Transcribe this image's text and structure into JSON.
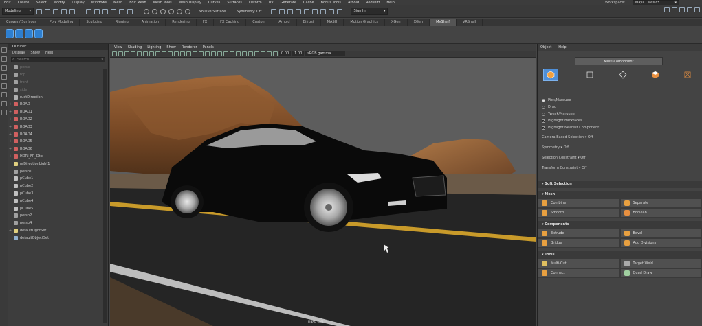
{
  "menubar": [
    "Edit",
    "Create",
    "Select",
    "Modify",
    "Display",
    "Windows",
    "Mesh",
    "Edit Mesh",
    "Mesh Tools",
    "Mesh Display",
    "Curves",
    "Surfaces",
    "Deform",
    "UV",
    "Generate",
    "Cache",
    "Bonus Tools",
    "Arnold",
    "Redshift",
    "Help"
  ],
  "workspace": {
    "label": "Workspace:",
    "value": "Maya Classic*"
  },
  "statusline": {
    "mode": "Modeling",
    "live_surface": "No Live Surface",
    "symmetry": "Symmetry: Off",
    "sign_in": "Sign In"
  },
  "shelf_tabs": [
    "Curves / Surfaces",
    "Poly Modeling",
    "Sculpting",
    "Rigging",
    "Animation",
    "Rendering",
    "FX",
    "FX Caching",
    "Custom",
    "Arnold",
    "Bifrost",
    "MASH",
    "Motion Graphics",
    "XGen",
    "XGen",
    "MyShelf",
    "VRShelf"
  ],
  "shelf_tabs_active_index": 15,
  "outliner": {
    "title": "Outliner",
    "menus": [
      "Display",
      "Show",
      "Help"
    ],
    "search_placeholder": "Search...",
    "items": [
      {
        "label": "persp",
        "dim": true,
        "expand": ""
      },
      {
        "label": "top",
        "dim": true,
        "expand": ""
      },
      {
        "label": "front",
        "dim": true,
        "expand": ""
      },
      {
        "label": "side",
        "dim": true,
        "expand": ""
      },
      {
        "label": "ruotDirection",
        "dim": false,
        "expand": ""
      },
      {
        "label": "ROAD",
        "dim": false,
        "expand": "+"
      },
      {
        "label": "ROAD1",
        "dim": false,
        "expand": "+"
      },
      {
        "label": "ROAD2",
        "dim": false,
        "expand": "+"
      },
      {
        "label": "ROAD3",
        "dim": false,
        "expand": "+"
      },
      {
        "label": "ROAD4",
        "dim": false,
        "expand": "+"
      },
      {
        "label": "ROAD5",
        "dim": false,
        "expand": "+"
      },
      {
        "label": "ROAD6",
        "dim": false,
        "expand": "+"
      },
      {
        "label": "HDRI_FR_Dtb",
        "dim": false,
        "expand": "+"
      },
      {
        "label": "nrDirectionLight1",
        "dim": false,
        "expand": ""
      },
      {
        "label": "persp1",
        "dim": false,
        "expand": ""
      },
      {
        "label": "pCube1",
        "dim": false,
        "expand": ""
      },
      {
        "label": "pCube2",
        "dim": false,
        "expand": ""
      },
      {
        "label": "pCube3",
        "dim": false,
        "expand": ""
      },
      {
        "label": "pCube4",
        "dim": false,
        "expand": ""
      },
      {
        "label": "pCube5",
        "dim": false,
        "expand": ""
      },
      {
        "label": "persp2",
        "dim": false,
        "expand": ""
      },
      {
        "label": "persp4",
        "dim": false,
        "expand": ""
      },
      {
        "label": "defaultLightSet",
        "dim": false,
        "expand": "+"
      },
      {
        "label": "defaultObjectSet",
        "dim": false,
        "expand": ""
      }
    ]
  },
  "viewport": {
    "menus": [
      "View",
      "Shading",
      "Lighting",
      "Show",
      "Renderer",
      "Panels"
    ],
    "near_value": "0.00",
    "gamma_value": "1.00",
    "color_space": "sRGB gamma",
    "camera_label": "FINAL_CAM"
  },
  "modeling_toolkit": {
    "menus": [
      "Object",
      "Help"
    ],
    "multi_component": "Multi-Component",
    "selection_modes": [
      {
        "label": "Pick/Marquee",
        "on": true
      },
      {
        "label": "Drag",
        "on": false
      },
      {
        "label": "Tweak/Marquee",
        "on": false
      }
    ],
    "checks": [
      "Highlight Backfaces",
      "Highlight Nearest Component"
    ],
    "options": [
      "Camera Based Selection  ▾  Off",
      "Symmetry  ▾  Off",
      "Selection Constraint  ▾  Off",
      "Transform Constraint  ▾  Off"
    ],
    "soft_selection": "Soft Selection",
    "sections": [
      {
        "title": "Mesh",
        "buttons": [
          [
            "Combine",
            "Separate"
          ],
          [
            "Smooth",
            "Boolean"
          ]
        ]
      },
      {
        "title": "Components",
        "buttons": [
          [
            "Extrude",
            "Bevel"
          ],
          [
            "Bridge",
            "Add Divisions"
          ]
        ]
      },
      {
        "title": "Tools",
        "buttons": [
          [
            "Multi-Cut",
            "Target Weld"
          ],
          [
            "Connect",
            "Quad Draw"
          ]
        ]
      }
    ]
  },
  "colors": {
    "accent": "#4f8fd8",
    "panel": "#444444",
    "viewport_bg": "#5b5b5b"
  }
}
